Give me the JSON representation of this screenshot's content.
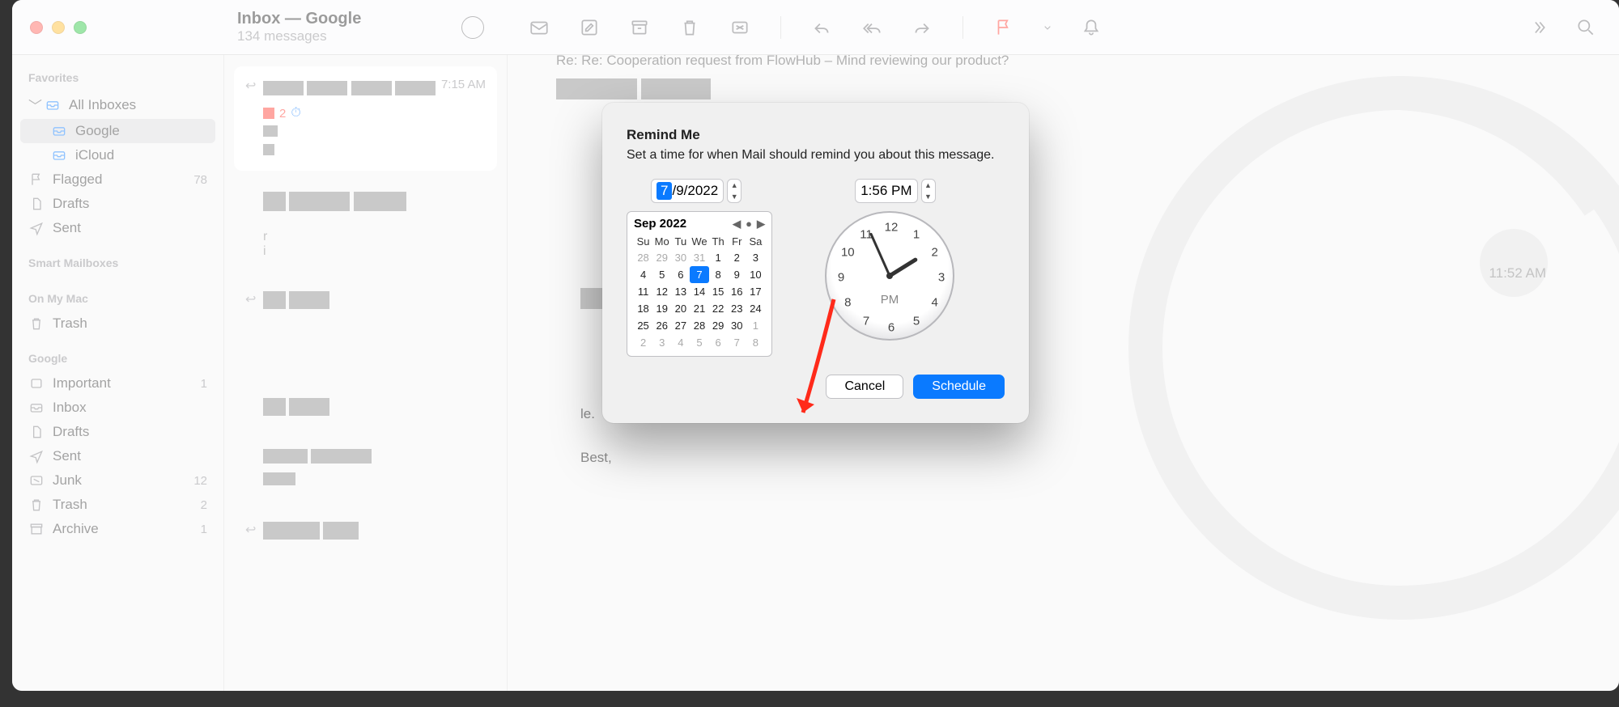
{
  "window": {
    "inbox_title": "Inbox — Google",
    "inbox_subtitle": "134 messages"
  },
  "sidebar": {
    "section_favorites": "Favorites",
    "all_inboxes": "All Inboxes",
    "google": "Google",
    "icloud": "iCloud",
    "flagged": "Flagged",
    "flagged_count": "78",
    "drafts": "Drafts",
    "sent": "Sent",
    "section_smart": "Smart Mailboxes",
    "section_onmymac": "On My Mac",
    "trash": "Trash",
    "section_google": "Google",
    "important": "Important",
    "important_count": "1",
    "inbox": "Inbox",
    "drafts2": "Drafts",
    "sent2": "Sent",
    "junk": "Junk",
    "junk_count": "12",
    "trash2": "Trash",
    "trash2_count": "2",
    "archive": "Archive",
    "archive_count": "1"
  },
  "message_list": {
    "item0_time": "7:15 AM",
    "item0_badge": "2",
    "item2_time": "11:52 AM"
  },
  "message_view": {
    "subject_fragment": "Re: Re: Cooperation request from FlowHub – Mind reviewing our product?",
    "body_frag1": "Best,"
  },
  "dialog": {
    "title": "Remind Me",
    "desc": "Set a time for when Mail should remind you about this message.",
    "date_day": "7",
    "date_sep": "/ ",
    "date_rest": "9/2022",
    "time_value": "1:56 PM",
    "cal_title": "Sep 2022",
    "dow": [
      "Su",
      "Mo",
      "Tu",
      "We",
      "Th",
      "Fr",
      "Sa"
    ],
    "weeks": [
      [
        {
          "n": "28",
          "o": true
        },
        {
          "n": "29",
          "o": true
        },
        {
          "n": "30",
          "o": true
        },
        {
          "n": "31",
          "o": true
        },
        {
          "n": "1"
        },
        {
          "n": "2"
        },
        {
          "n": "3"
        }
      ],
      [
        {
          "n": "4"
        },
        {
          "n": "5"
        },
        {
          "n": "6"
        },
        {
          "n": "7",
          "sel": true
        },
        {
          "n": "8"
        },
        {
          "n": "9"
        },
        {
          "n": "10"
        }
      ],
      [
        {
          "n": "11"
        },
        {
          "n": "12"
        },
        {
          "n": "13"
        },
        {
          "n": "14"
        },
        {
          "n": "15"
        },
        {
          "n": "16"
        },
        {
          "n": "17"
        }
      ],
      [
        {
          "n": "18"
        },
        {
          "n": "19"
        },
        {
          "n": "20"
        },
        {
          "n": "21"
        },
        {
          "n": "22"
        },
        {
          "n": "23"
        },
        {
          "n": "24"
        }
      ],
      [
        {
          "n": "25"
        },
        {
          "n": "26"
        },
        {
          "n": "27"
        },
        {
          "n": "28"
        },
        {
          "n": "29"
        },
        {
          "n": "30"
        },
        {
          "n": "1",
          "o": true
        }
      ],
      [
        {
          "n": "2",
          "o": true
        },
        {
          "n": "3",
          "o": true
        },
        {
          "n": "4",
          "o": true
        },
        {
          "n": "5",
          "o": true
        },
        {
          "n": "6",
          "o": true
        },
        {
          "n": "7",
          "o": true
        },
        {
          "n": "8",
          "o": true
        }
      ]
    ],
    "clock_numbers": [
      "12",
      "1",
      "2",
      "3",
      "4",
      "5",
      "6",
      "7",
      "8",
      "9",
      "10",
      "11"
    ],
    "ampm": "PM",
    "cancel": "Cancel",
    "schedule": "Schedule"
  }
}
